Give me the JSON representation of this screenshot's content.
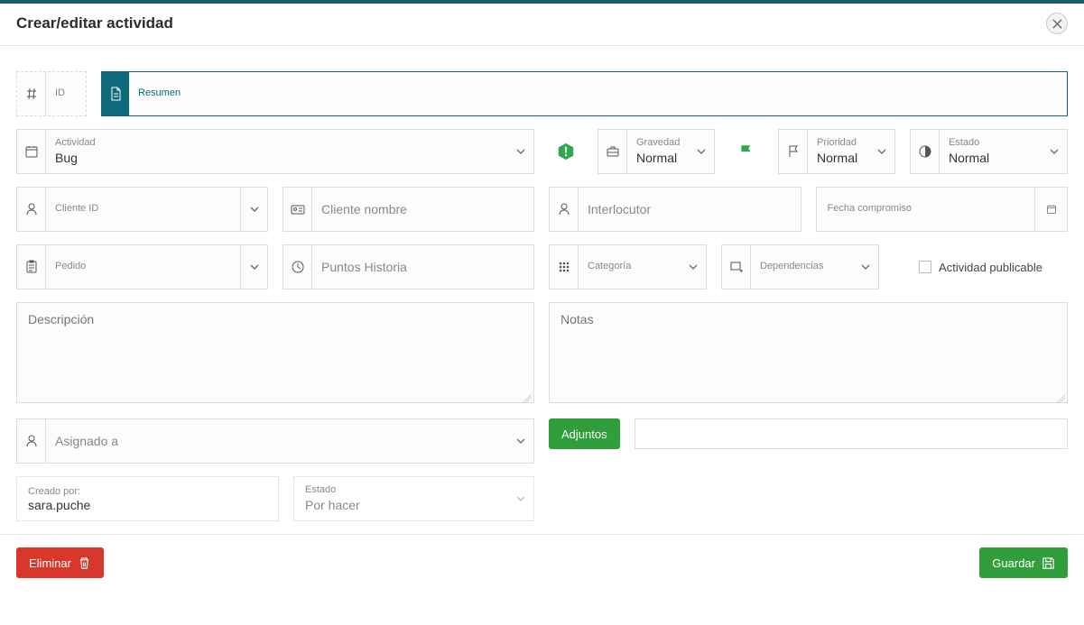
{
  "header": {
    "title": "Crear/editar actividad"
  },
  "id_field": {
    "label": "ID",
    "value": ""
  },
  "summary": {
    "label": "Resumen",
    "value": ""
  },
  "activity": {
    "label": "Actividad",
    "value": "Bug"
  },
  "severity": {
    "label": "Gravedad",
    "value": "Normal"
  },
  "priority": {
    "label": "Prioridad",
    "value": "Normal"
  },
  "status_circle": {
    "label": "Estado",
    "value": "Normal"
  },
  "client_id": {
    "label": "Cliente ID",
    "value": ""
  },
  "client_name": {
    "placeholder": "Cliente nombre"
  },
  "interlocutor": {
    "placeholder": "Interlocutor"
  },
  "commit_date": {
    "label": "Fecha compromiso",
    "value": ""
  },
  "order": {
    "label": "Pedido",
    "value": ""
  },
  "story_points": {
    "placeholder": "Puntos Historia"
  },
  "category": {
    "label": "Categoría",
    "value": ""
  },
  "dependencies": {
    "label": "Dependencias",
    "value": ""
  },
  "publishable": {
    "label": "Actividad publicable"
  },
  "description": {
    "placeholder": "Descripción"
  },
  "notes": {
    "placeholder": "Notas"
  },
  "assigned_to": {
    "placeholder": "Asignado a"
  },
  "attachments": {
    "button": "Adjuntos"
  },
  "created_by": {
    "label": "Creado por:",
    "value": "sara.puche"
  },
  "state": {
    "label": "Estado",
    "value": "Por hacer"
  },
  "footer": {
    "delete": "Eliminar",
    "save": "Guardar"
  }
}
